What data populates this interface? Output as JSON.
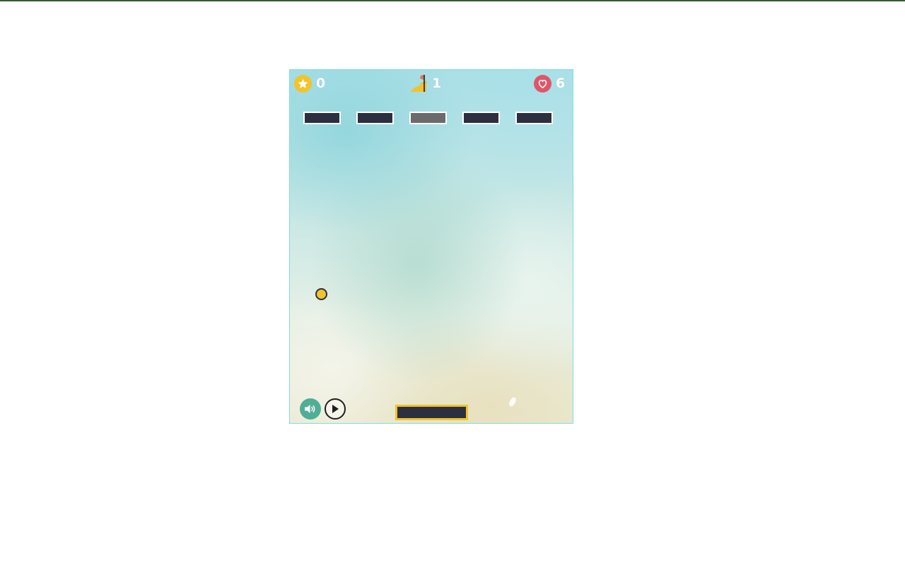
{
  "hud": {
    "score": "0",
    "level": "1",
    "lives": "6"
  },
  "bricks": [
    {
      "color": "#2c2f40"
    },
    {
      "color": "#2c2f40"
    },
    {
      "color": "#6b6b6b"
    },
    {
      "color": "#2c2f40"
    },
    {
      "color": "#2c2f40"
    }
  ],
  "controls": {
    "sound_icon": "speaker-icon",
    "play_icon": "play-icon"
  },
  "colors": {
    "accent_yellow": "#f2c22b",
    "heart_red": "#e05568",
    "brick_dark": "#2c2f40",
    "brick_gray": "#6b6b6b",
    "sound_green": "#4fae95"
  }
}
